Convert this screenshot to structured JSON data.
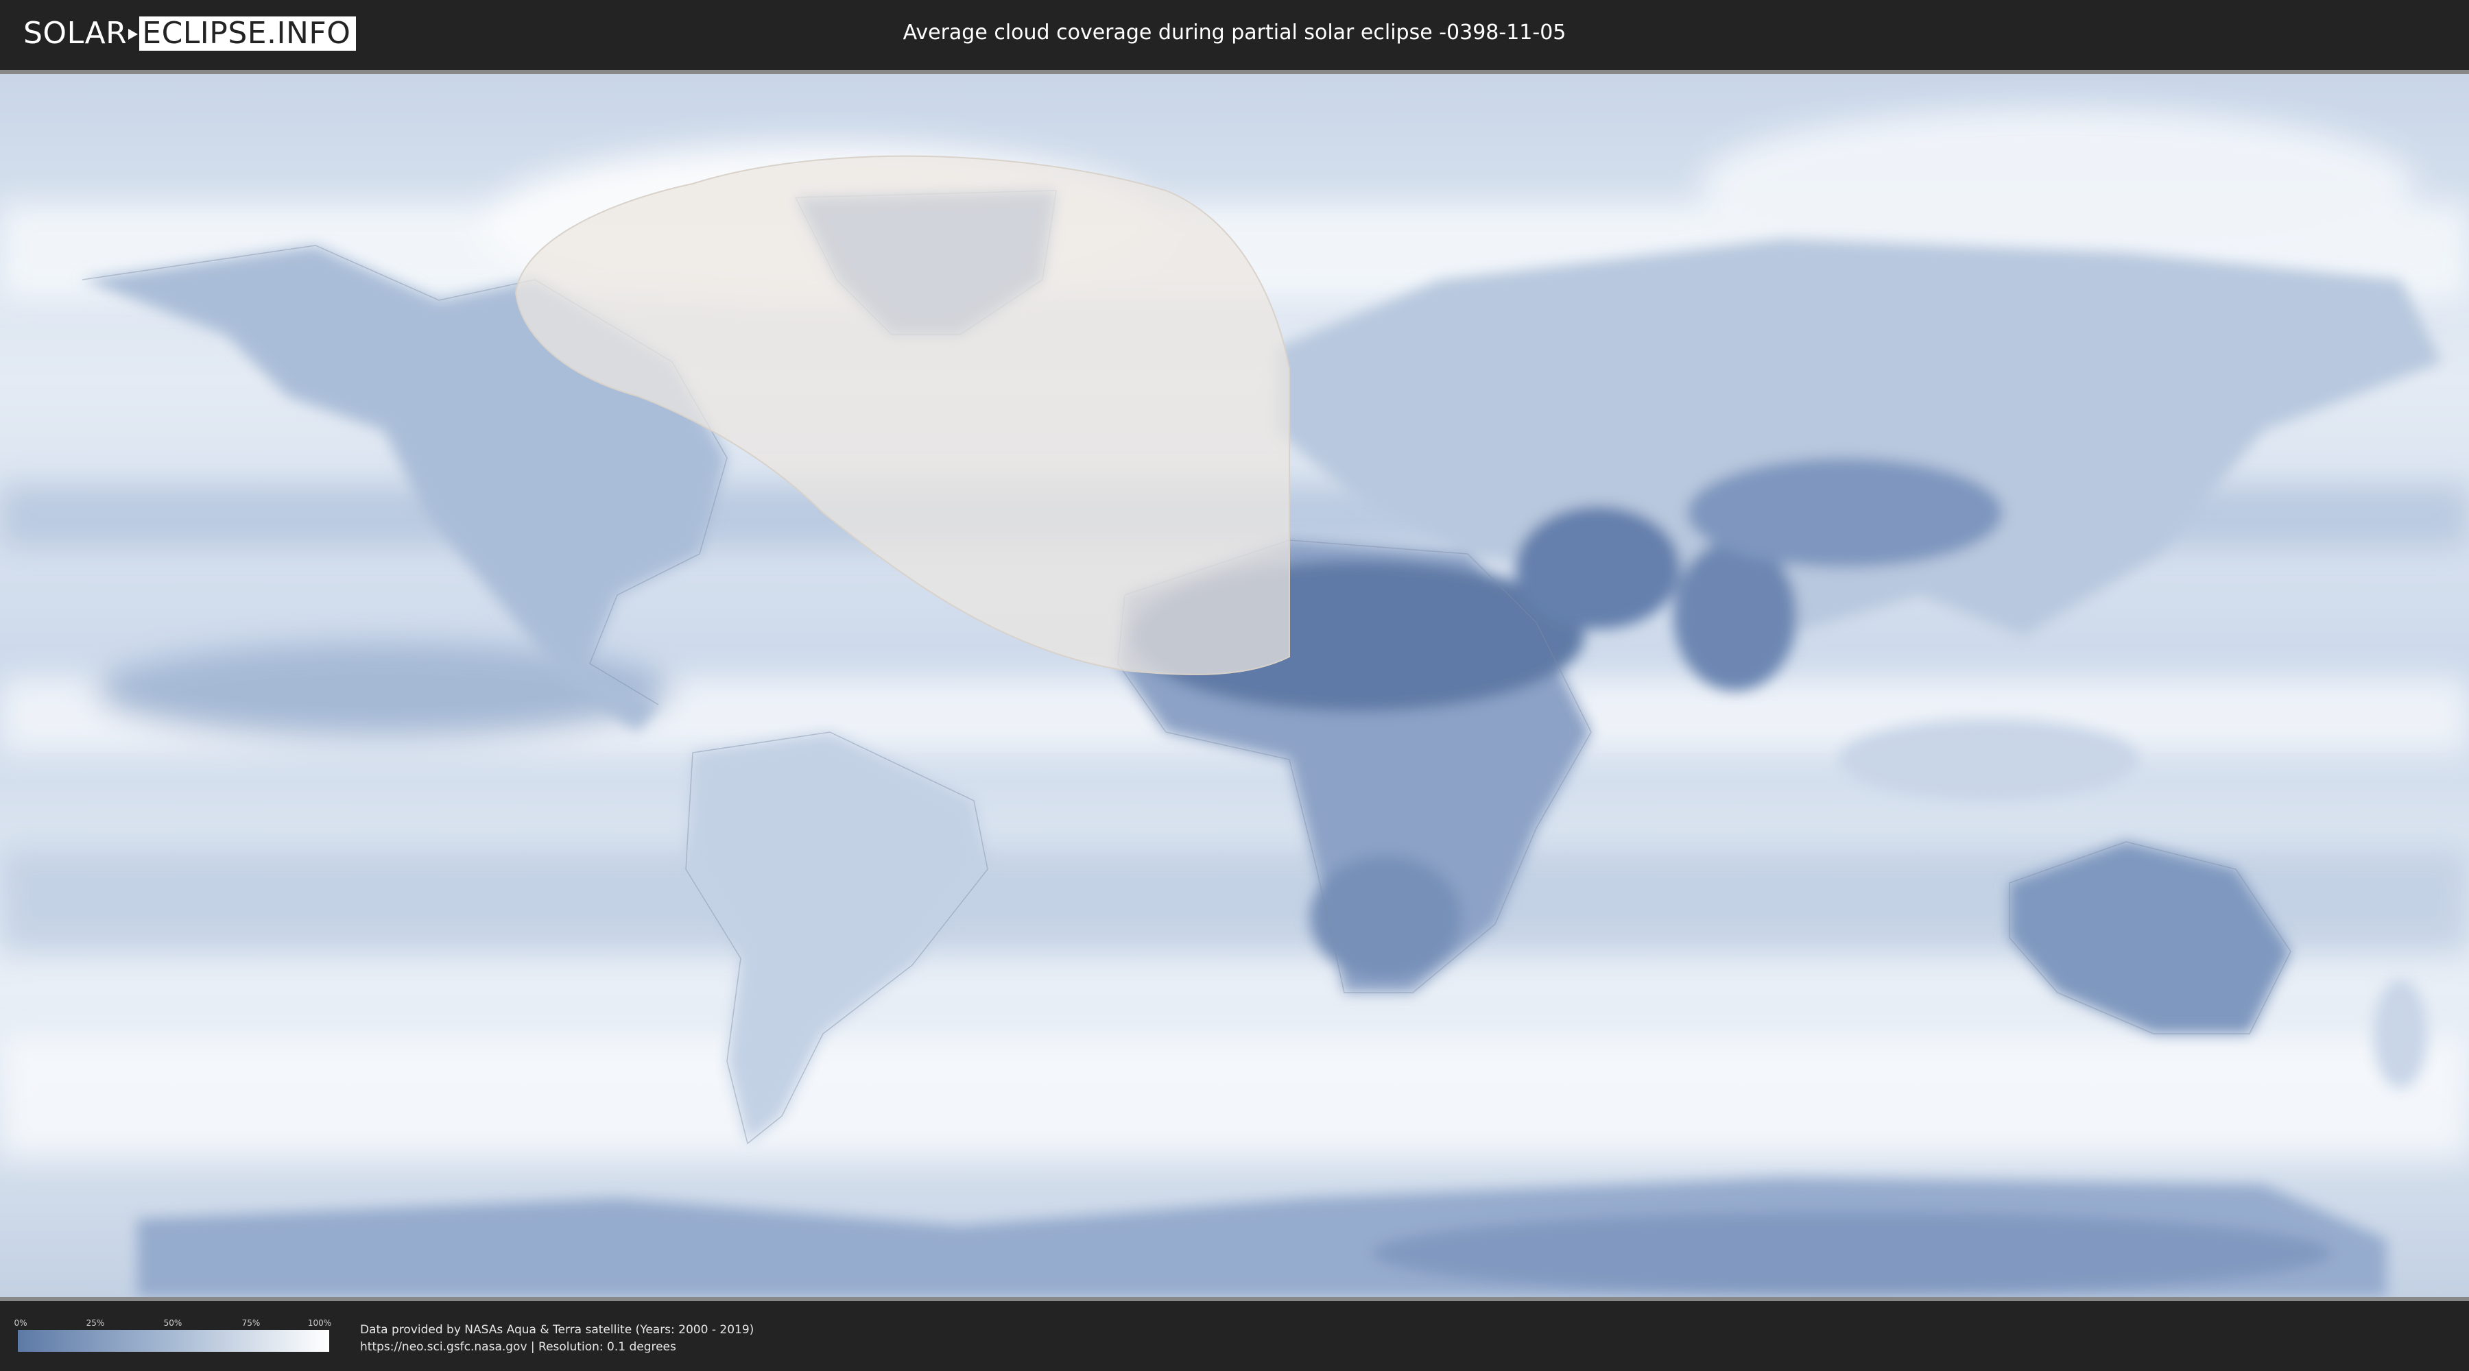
{
  "header": {
    "logo_left": "SOLAR",
    "logo_right": "ECLIPSE.INFO",
    "title": "Average cloud coverage during partial solar eclipse -0398-11-05"
  },
  "legend": {
    "ticks": [
      "0%",
      "25%",
      "50%",
      "75%",
      "100%"
    ],
    "colors": {
      "low": "#5d7aa6",
      "high": "#ffffff"
    }
  },
  "credits": {
    "line1": "Data provided by NASAs Aqua & Terra satellite (Years: 2000 - 2019)",
    "line2": "https://neo.sci.gsfc.nasa.gov | Resolution: 0.1 degrees"
  },
  "map": {
    "eclipse_region": "partial eclipse visibility zone",
    "colors": {
      "ocean": "#dde6f1",
      "land_clear": "#6f89b3",
      "cloudy": "#f4f7fb",
      "eclipse_overlay": "#e8e3dc"
    }
  }
}
